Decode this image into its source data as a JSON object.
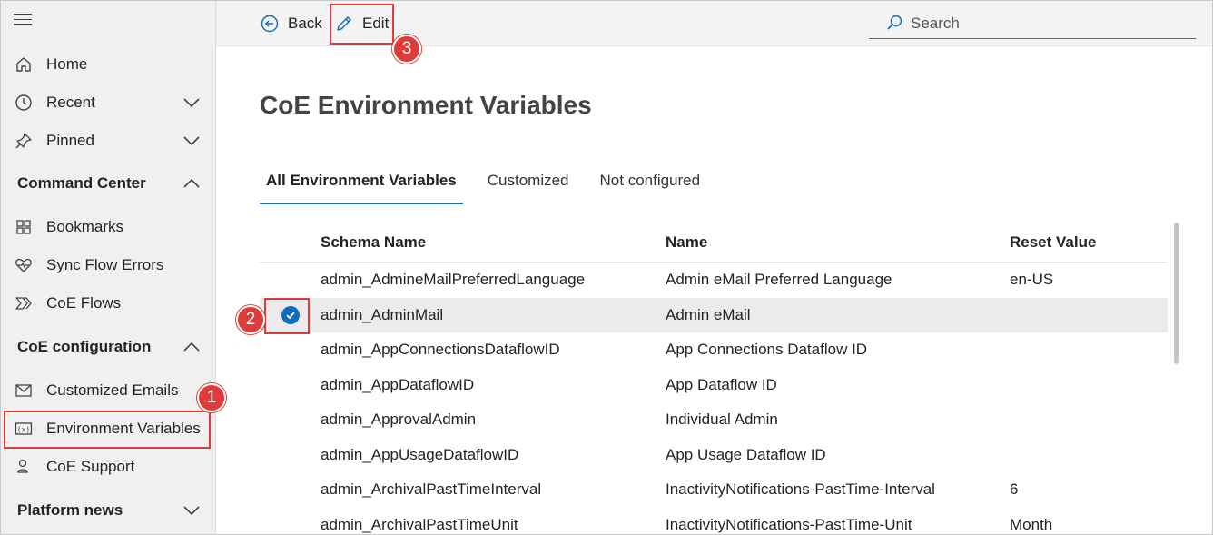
{
  "sidebar": {
    "home": "Home",
    "recent": "Recent",
    "pinned": "Pinned",
    "command_center": "Command Center",
    "bookmarks": "Bookmarks",
    "sync_flow_errors": "Sync Flow Errors",
    "coe_flows": "CoE Flows",
    "coe_configuration": "CoE configuration",
    "customized_emails": "Customized Emails",
    "environment_variables": "Environment Variables",
    "coe_support": "CoE Support",
    "platform_news": "Platform news"
  },
  "toolbar": {
    "back_label": "Back",
    "edit_label": "Edit",
    "search_placeholder": "Search"
  },
  "page": {
    "title": "CoE Environment Variables"
  },
  "tabs": [
    {
      "label": "All Environment Variables",
      "active": true
    },
    {
      "label": "Customized",
      "active": false
    },
    {
      "label": "Not configured",
      "active": false
    }
  ],
  "table": {
    "headers": [
      "Schema Name",
      "Name",
      "Reset Value"
    ],
    "rows": [
      {
        "schema": "admin_AdmineMailPreferredLanguage",
        "name": "Admin eMail Preferred Language",
        "reset": "en-US"
      },
      {
        "schema": "admin_AdminMail",
        "name": "Admin eMail",
        "reset": ""
      },
      {
        "schema": "admin_AppConnectionsDataflowID",
        "name": "App Connections Dataflow ID",
        "reset": ""
      },
      {
        "schema": "admin_AppDataflowID",
        "name": "App Dataflow ID",
        "reset": ""
      },
      {
        "schema": "admin_ApprovalAdmin",
        "name": "Individual Admin",
        "reset": ""
      },
      {
        "schema": "admin_AppUsageDataflowID",
        "name": "App Usage Dataflow ID",
        "reset": ""
      },
      {
        "schema": "admin_ArchivalPastTimeInterval",
        "name": "InactivityNotifications-PastTime-Interval",
        "reset": "6"
      },
      {
        "schema": "admin_ArchivalPastTimeUnit",
        "name": "InactivityNotifications-PastTime-Unit",
        "reset": "Month"
      }
    ]
  },
  "annotations": {
    "badge1": "1",
    "badge2": "2",
    "badge3": "3"
  },
  "colors": {
    "accent": "#0f6cbd",
    "annotation": "#e03b3b"
  }
}
